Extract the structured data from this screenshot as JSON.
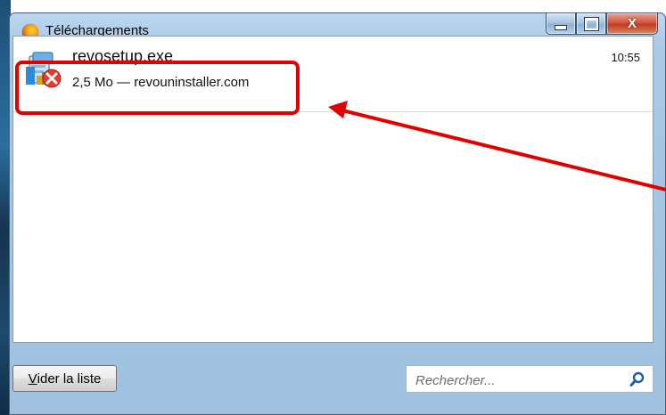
{
  "window": {
    "title": "Téléchargements",
    "app_icon": "firefox-icon",
    "close_label": "X"
  },
  "downloads": [
    {
      "name": "revosetup.exe",
      "meta": "2,5 Mo — revouninstaller.com",
      "time": "10:55",
      "icon": "failed-installer-icon"
    }
  ],
  "footer": {
    "clear_first_letter": "V",
    "clear_rest": "ider la liste",
    "search_placeholder": "Rechercher..."
  },
  "colors": {
    "annotation": "#e00000",
    "titlebar": "#a9c9e6",
    "close_button": "#c03b22"
  }
}
